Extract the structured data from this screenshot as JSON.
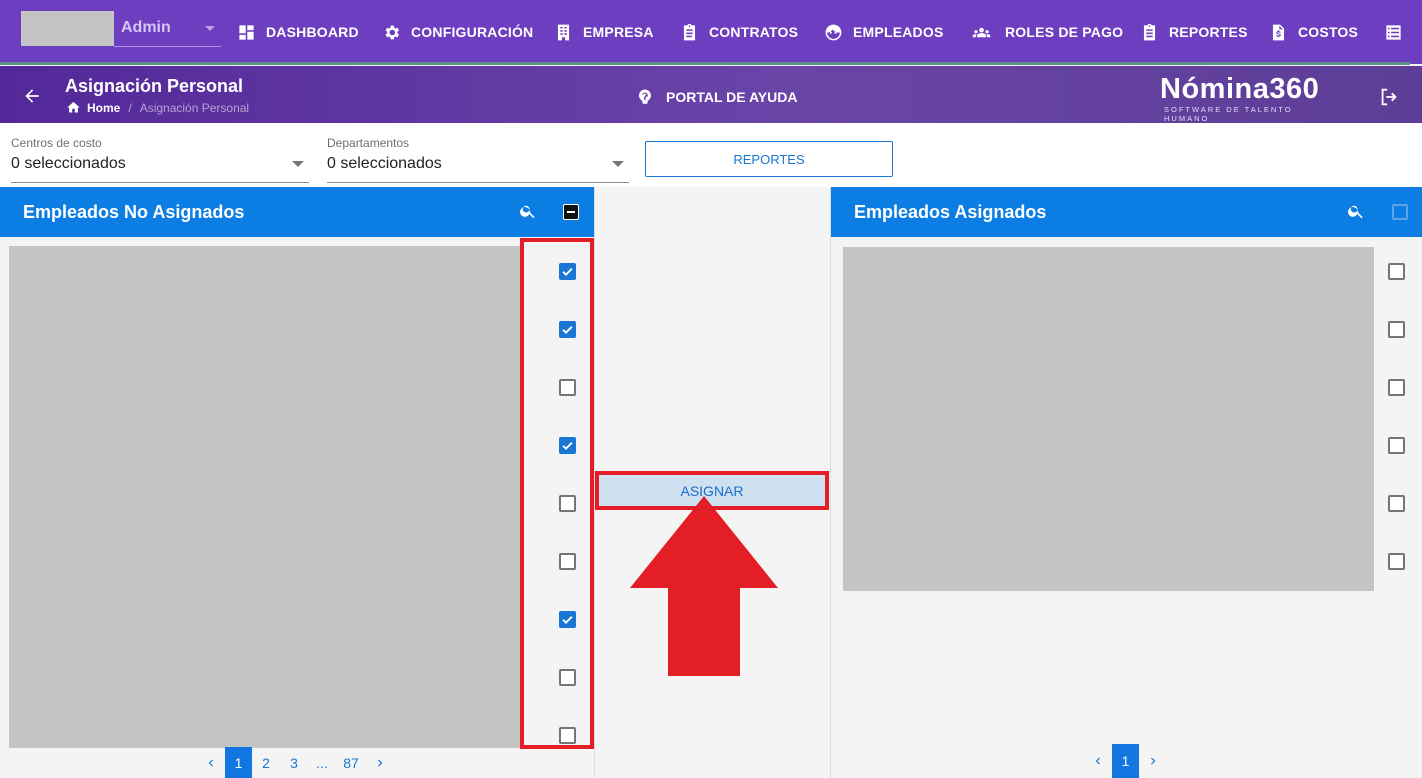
{
  "user": {
    "role": "Admin"
  },
  "nav": {
    "items": [
      {
        "id": "dashboard",
        "label": "DASHBOARD",
        "icon": "dashboard-icon"
      },
      {
        "id": "configuracion",
        "label": "CONFIGURACIÓN",
        "icon": "gear-icon"
      },
      {
        "id": "empresa",
        "label": "EMPRESA",
        "icon": "building-icon"
      },
      {
        "id": "contratos",
        "label": "CONTRATOS",
        "icon": "clipboard-icon"
      },
      {
        "id": "empleados",
        "label": "EMPLEADOS",
        "icon": "face-icon"
      },
      {
        "id": "roles",
        "label": "ROLES DE PAGO",
        "icon": "group-icon"
      },
      {
        "id": "reportes",
        "label": "REPORTES",
        "icon": "report-icon"
      },
      {
        "id": "costos",
        "label": "COSTOS",
        "icon": "invoice-icon"
      },
      {
        "id": "more",
        "label": "",
        "icon": "list-icon"
      }
    ]
  },
  "header": {
    "title": "Asignación Personal",
    "breadcrumb_home": "Home",
    "breadcrumb_separator": "/",
    "breadcrumb_current": "Asignación Personal",
    "help_label": "PORTAL DE AYUDA",
    "logo_main": "Nómina360",
    "logo_sub": "SOFTWARE DE TALENTO HUMANO"
  },
  "filters": {
    "cost_centers": {
      "label": "Centros de costo",
      "value": "0 seleccionados"
    },
    "departments": {
      "label": "Departamentos",
      "value": "0 seleccionados"
    },
    "reports_button": "REPORTES"
  },
  "left_panel": {
    "title": "Empleados No Asignados",
    "header_check_state": "indeterminate",
    "rows_checked": [
      true,
      true,
      false,
      true,
      false,
      false,
      true,
      false,
      false
    ],
    "pagination": {
      "pages": [
        "1",
        "2",
        "3",
        "...",
        "87"
      ],
      "active": "1"
    }
  },
  "middle": {
    "assign_label": "ASIGNAR"
  },
  "right_panel": {
    "title": "Empleados Asignados",
    "header_check_state": "unchecked",
    "rows_checked": [
      false,
      false,
      false,
      false,
      false,
      false
    ],
    "pagination": {
      "pages": [
        "1"
      ],
      "active": "1"
    }
  },
  "colors": {
    "topbar": "#6d3fc0",
    "panel_header": "#0c7ee3",
    "accent": "#1976d2",
    "annotation_red": "#e41e26"
  }
}
